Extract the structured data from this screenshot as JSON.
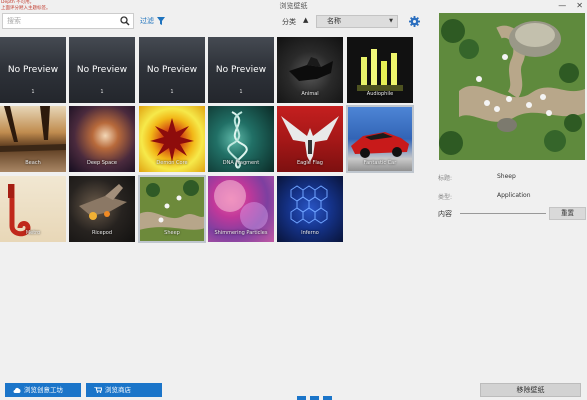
{
  "window": {
    "title": "浏览壁纸",
    "warning_line1": "Depth 不可用。",
    "warning_line2": "上面评分陋入主题标签。",
    "minimize": "—",
    "close": "✕"
  },
  "toolbar": {
    "search_placeholder": "搜索",
    "filter_label": "过滤",
    "sort_label": "分类",
    "sort_direction": "▲",
    "sort_value": "名称"
  },
  "wallpapers": [
    {
      "name": "No Preview",
      "caption": "1",
      "type": "nopreview"
    },
    {
      "name": "No Preview",
      "caption": "1",
      "type": "nopreview"
    },
    {
      "name": "No Preview",
      "caption": "1",
      "type": "nopreview"
    },
    {
      "name": "No Preview",
      "caption": "1",
      "type": "nopreview"
    },
    {
      "caption": "Animal"
    },
    {
      "caption": "Audiophile"
    },
    {
      "caption": "Beach"
    },
    {
      "caption": "Deep Space"
    },
    {
      "caption": "Demon Core"
    },
    {
      "caption": "DNA Fragment"
    },
    {
      "caption": "Eagle Flag"
    },
    {
      "caption": "Fantastic Car"
    },
    {
      "caption": "Metro"
    },
    {
      "caption": "Ricepod"
    },
    {
      "caption": "Sheep"
    },
    {
      "caption": "Shimmering Particles"
    },
    {
      "caption": "Inferno"
    }
  ],
  "details": {
    "title_label": "标题:",
    "title_value": "Sheep",
    "type_label": "类型:",
    "type_value": "Application",
    "content_label": "内容",
    "reset_label": "重置"
  },
  "footer": {
    "workshop_label": "浏览创意工坊",
    "store_label": "浏览商店",
    "remove_label": "移除壁纸"
  },
  "colors": {
    "accent": "#1b75c9",
    "background": "#f0f0f0"
  },
  "icons": [
    "search-icon",
    "filter-icon",
    "gear-icon",
    "cloud-icon",
    "cart-icon"
  ]
}
